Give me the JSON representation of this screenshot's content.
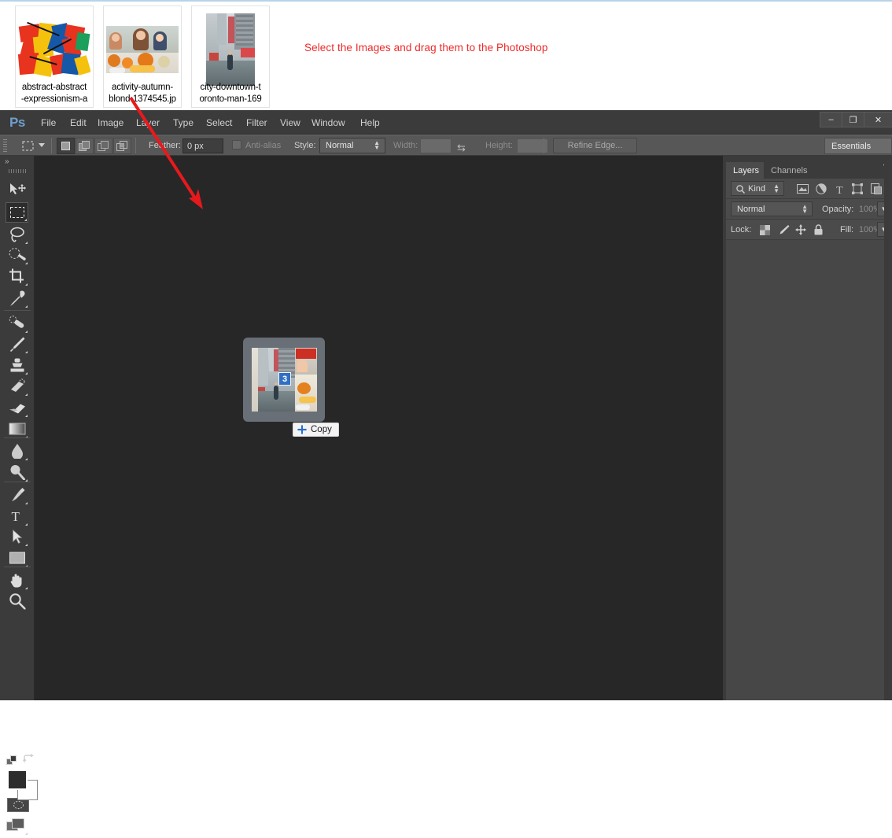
{
  "explorer": {
    "annotation": "Select the Images and drag them to the Photoshop",
    "annotation_color": "#ef2a2a",
    "files": [
      {
        "name": "abstract-abstract\n-expressionism-a",
        "kind": "abstract-painting-thumbnail"
      },
      {
        "name": "activity-autumn-\nblond-1374545.jp",
        "kind": "family-pumpkins-thumbnail"
      },
      {
        "name": "city-downtown-t\noronto-man-169",
        "kind": "city-street-thumbnail"
      }
    ]
  },
  "app": {
    "logo": "Ps",
    "menus": [
      "File",
      "Edit",
      "Image",
      "Layer",
      "Type",
      "Select",
      "Filter",
      "View",
      "Window",
      "Help"
    ],
    "window_controls": {
      "minimize": "–",
      "maximize": "❐",
      "close": "✕"
    }
  },
  "options_bar": {
    "tool_preset": "marquee-tool-preset",
    "selection_modes": [
      "new-selection",
      "add-to-selection",
      "subtract-from-selection",
      "intersect-with-selection"
    ],
    "active_mode_index": 0,
    "feather_label": "Feather:",
    "feather_value": "0 px",
    "antialias_label": "Anti-alias",
    "antialias_checked": false,
    "style_label": "Style:",
    "style_value": "Normal",
    "width_label": "Width:",
    "width_value": "",
    "height_label": "Height:",
    "height_value": "",
    "swap_icon": "swap-dimensions-icon",
    "refine_edge_label": "Refine Edge...",
    "workspace": "Essentials"
  },
  "toolbox": {
    "collapse_icon": "collapse-panel-icon",
    "tools": [
      {
        "name": "move-tool",
        "selected": false
      },
      {
        "name": "rectangular-marquee-tool",
        "selected": true
      },
      {
        "name": "lasso-tool",
        "selected": false
      },
      {
        "name": "quick-selection-tool",
        "selected": false
      },
      {
        "name": "crop-tool",
        "selected": false
      },
      {
        "name": "eyedropper-tool",
        "selected": false
      },
      {
        "name": "spot-healing-brush-tool",
        "selected": false
      },
      {
        "name": "brush-tool",
        "selected": false
      },
      {
        "name": "clone-stamp-tool",
        "selected": false
      },
      {
        "name": "history-brush-tool",
        "selected": false
      },
      {
        "name": "eraser-tool",
        "selected": false
      },
      {
        "name": "gradient-tool",
        "selected": false
      },
      {
        "name": "blur-tool",
        "selected": false
      },
      {
        "name": "dodge-tool",
        "selected": false
      },
      {
        "name": "pen-tool",
        "selected": false
      },
      {
        "name": "horizontal-type-tool",
        "selected": false
      },
      {
        "name": "path-selection-tool",
        "selected": false
      },
      {
        "name": "rectangle-tool",
        "selected": false
      },
      {
        "name": "hand-tool",
        "selected": false
      },
      {
        "name": "zoom-tool",
        "selected": false
      }
    ],
    "foreground_color": "#2d2d2d",
    "background_color": "#ffffff",
    "quick_mask": "edit-in-quick-mask-mode",
    "screen_mode": "change-screen-mode"
  },
  "canvas": {
    "background_color": "#272727",
    "drag_ghost": {
      "file_count": "3",
      "copy_tooltip": "Copy",
      "plus_icon": "copy-plus-icon"
    }
  },
  "layers_panel": {
    "tabs": [
      {
        "label": "Layers",
        "active": true
      },
      {
        "label": "Channels",
        "active": false
      }
    ],
    "menu_icon": "panel-menu-icon",
    "filter": {
      "kind_label": "Kind",
      "search_icon": "search-icon",
      "type_icons": [
        "pixel-layer-filter-icon",
        "adjustment-layer-filter-icon",
        "type-layer-filter-icon",
        "shape-layer-filter-icon",
        "smart-object-filter-icon"
      ],
      "toggle_icon": "filter-toggle-icon"
    },
    "blend_mode": "Normal",
    "opacity_label": "Opacity:",
    "opacity_value": "100%",
    "lock_label": "Lock:",
    "lock_icons": [
      "lock-transparent-pixels-icon",
      "lock-image-pixels-icon",
      "lock-position-icon",
      "lock-all-icon"
    ],
    "fill_label": "Fill:",
    "fill_value": "100%",
    "layers": []
  }
}
